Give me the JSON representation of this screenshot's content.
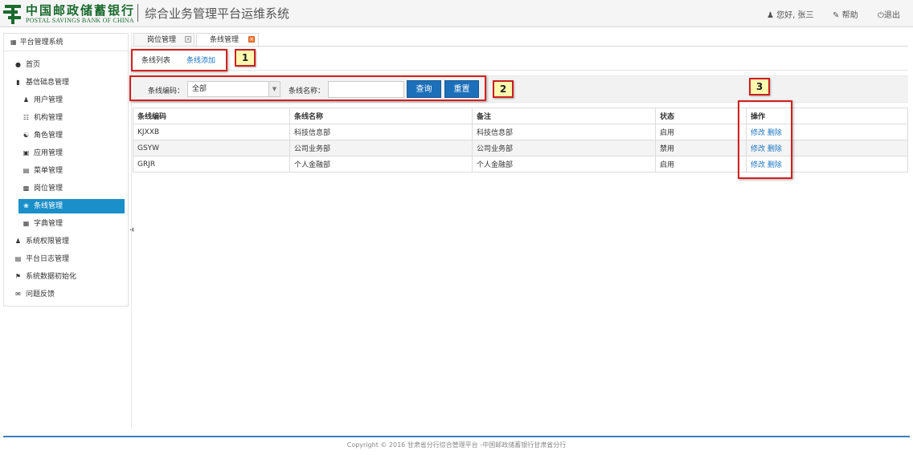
{
  "header": {
    "bank_cn": "中国邮政储蓄银行",
    "bank_en": "POSTAL SAVINGS BANK OF CHINA",
    "system_title": "综合业务管理平台运维系统",
    "user_greeting": "您好, 张三",
    "help_label": "帮助",
    "logout_label": "退出"
  },
  "sidebar": {
    "title": "平台管理系统",
    "items": [
      {
        "label": "首页",
        "icon": "globe-icon"
      },
      {
        "label": "基信础息管理",
        "icon": "book-icon"
      },
      {
        "label": "用户管理",
        "icon": "user-icon"
      },
      {
        "label": "机构管理",
        "icon": "sitemap-icon"
      },
      {
        "label": "角色管理",
        "icon": "group-icon"
      },
      {
        "label": "应用管理",
        "icon": "monitor-icon"
      },
      {
        "label": "菜单管理",
        "icon": "calendar-icon"
      },
      {
        "label": "岗位管理",
        "icon": "doc-icon"
      },
      {
        "label": "条线管理",
        "icon": "leaf-icon"
      },
      {
        "label": "字典管理",
        "icon": "grid-icon"
      },
      {
        "label": "系统权限管理",
        "icon": "tree-icon"
      },
      {
        "label": "平台日志管理",
        "icon": "calendar-icon"
      },
      {
        "label": "系统数据初始化",
        "icon": "flag-icon"
      },
      {
        "label": "问题反馈",
        "icon": "chat-icon"
      }
    ]
  },
  "tabs": {
    "tab1": "岗位管理",
    "tab2": "条线管理"
  },
  "subtabs": {
    "list": "条线列表",
    "add": "条线添加"
  },
  "filter": {
    "code_label": "条线编码：",
    "code_value": "全部",
    "name_label": "条线名称：",
    "name_value": "",
    "search_btn": "查询",
    "reset_btn": "重置"
  },
  "table": {
    "headers": [
      "条线编码",
      "条线名称",
      "备注",
      "状态",
      "操作"
    ],
    "rows": [
      {
        "code": "KJXXB",
        "name": "科技信息部",
        "remark": "科技信息部",
        "status": "启用"
      },
      {
        "code": "GSYW",
        "name": "公司业务部",
        "remark": "公司业务部",
        "status": "禁用"
      },
      {
        "code": "GRJR",
        "name": "个人金融部",
        "remark": "个人金融部",
        "status": "启用"
      }
    ],
    "edit_label": "修改",
    "delete_label": "删除"
  },
  "annotations": {
    "m1": "1",
    "m2": "2",
    "m3": "3"
  },
  "footer": {
    "text": "Copyright © 2016 甘肃省分行综合管理平台 -中国邮政储蓄银行甘肃省分行"
  },
  "colors": {
    "accent": "#1a8fc9",
    "button": "#1c6fb9",
    "link": "#1a75c4",
    "annotation_border": "#d42020"
  }
}
